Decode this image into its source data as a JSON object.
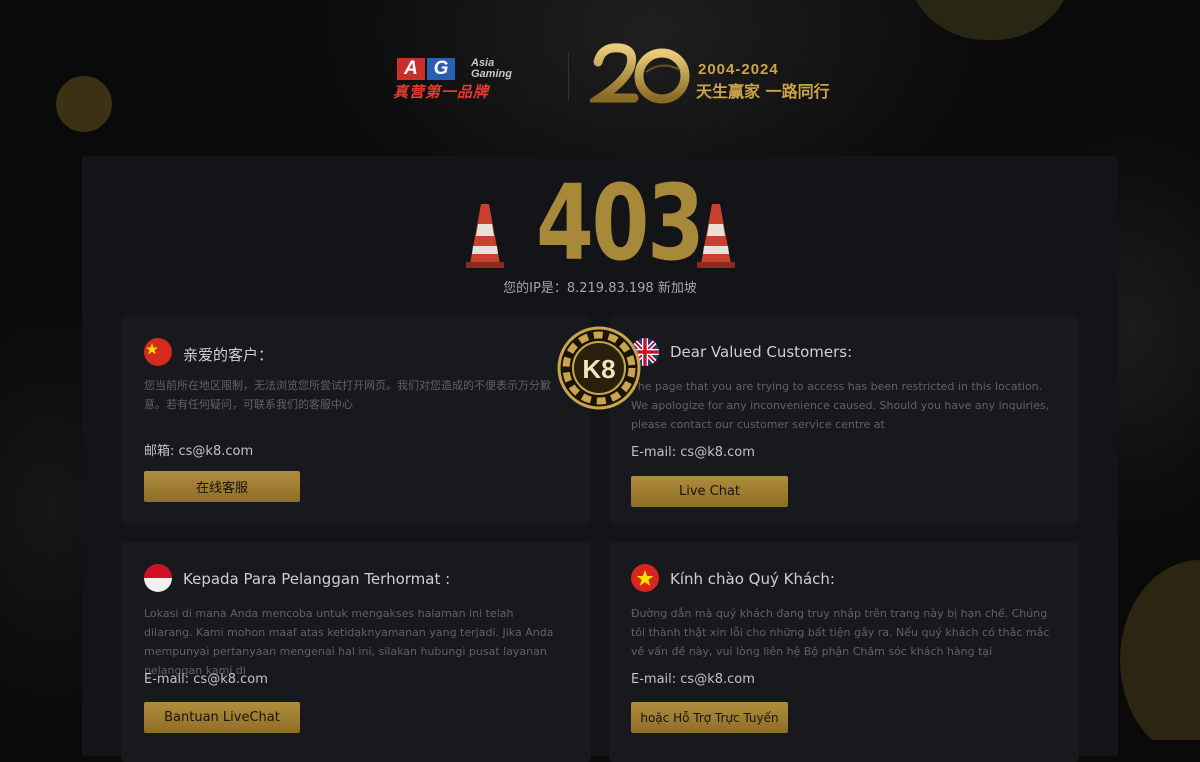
{
  "header": {
    "ag_letters": [
      "A",
      "G"
    ],
    "ag_sub": "Asia Gaming",
    "ag_slogan": "真营第一品牌",
    "anniversary_years": "2004-2024",
    "anniversary_slogan": "天生赢家 一路同行"
  },
  "error": {
    "code": "403",
    "ip_text": "您的IP是：8.219.83.198 新加坡"
  },
  "cards": {
    "zh": {
      "title": "亲爱的客户：",
      "desc": "您当前所在地区限制，无法浏览您所尝试打开网页。我们对您造成的不便表示万分歉意。若有任何疑问，可联系我们的客服中心",
      "email": "邮箱: cs@k8.com",
      "button": "在线客服",
      "flag": "china-flag"
    },
    "en": {
      "title": "Dear Valued Customers:",
      "desc": "The page that you are trying to access has been restricted in this location. We apologize for any inconvenience caused. Should you have any inquiries, please contact our customer service centre at",
      "email": "E-mail: cs@k8.com",
      "button": "Live Chat",
      "flag": "uk-flag"
    },
    "id": {
      "title": "Kepada Para Pelanggan Terhormat :",
      "desc": "Lokasi di mana Anda mencoba untuk mengakses halaman ini telah dilarang. Kami mohon maaf atas ketidaknyamanan yang terjadi. Jika Anda mempunyai pertanyaan mengenai hal ini, silakan hubungi pusat layanan pelanggan kami di",
      "email": "E-mail: cs@k8.com",
      "button": "Bantuan LiveChat",
      "flag": "indonesia-flag"
    },
    "vi": {
      "title": "Kính chào Quý Khách:",
      "desc": "Đường dẫn mà quý khách đang truy nhập trên trang này bị hạn chế. Chúng tôi thành thật xin lỗi cho những bất tiện gây ra. Nếu quý khách có thắc mắc về vấn đề này, vui lòng liên hệ Bộ phận Chăm sóc khách hàng tại",
      "email": "E-mail: cs@k8.com",
      "button": "hoặc Hỗ Trợ Trực Tuyến",
      "flag": "vietnam-flag"
    }
  },
  "k8_logo_text": "K8",
  "colors": {
    "gold": "#a8893a",
    "button": "#a07f34",
    "panel": "#131417",
    "card": "#17191d"
  }
}
